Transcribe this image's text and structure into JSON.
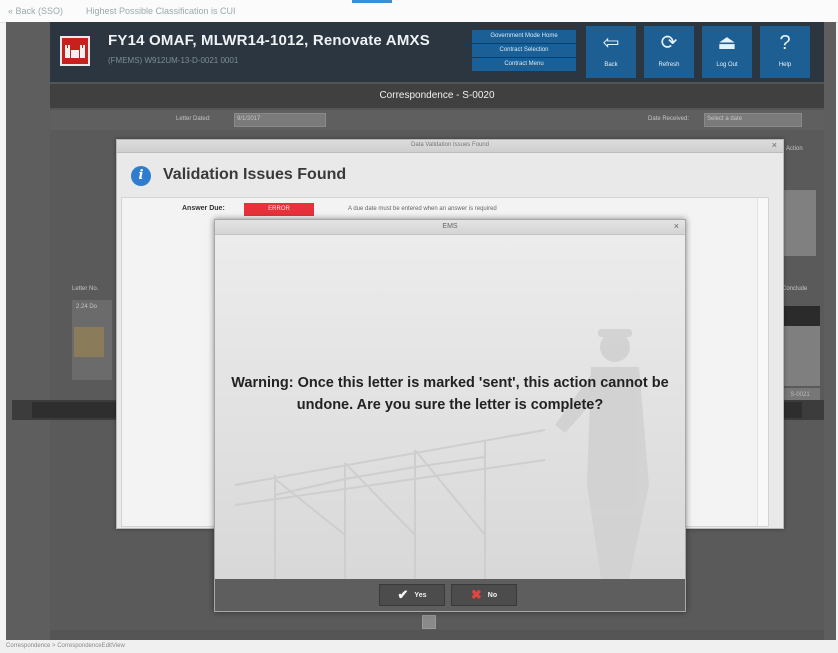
{
  "browser": {
    "crumb": "« Back (SSO)",
    "classification": "Highest Possible Classification is CUI"
  },
  "header": {
    "project_title": "FY14 OMAF, MLWR14-1012, Renovate AMXS",
    "project_subtitle": "(FMEMS) W912UM-13-D-0021 0001",
    "gov_buttons": [
      "Government Mode Home",
      "Contract Selection",
      "Contract Menu"
    ],
    "buttons": [
      {
        "label": "Back",
        "icon": "back-arrow-icon",
        "glyph": "⇦"
      },
      {
        "label": "Refresh",
        "icon": "refresh-icon",
        "glyph": "⟳"
      },
      {
        "label": "Log Out",
        "icon": "log-out-icon",
        "glyph": "⏏"
      },
      {
        "label": "Help",
        "icon": "help-icon",
        "glyph": "?"
      }
    ]
  },
  "subheader": {
    "title": "Correspondence - S-0020"
  },
  "background_form": {
    "letter_dated_label": "Letter Dated:",
    "letter_dated_value": "9/1/2017",
    "date_received_label": "Date Received:",
    "date_received_value": "Select a date",
    "letter_no_label": "Letter No.",
    "action_label": "Action",
    "conclude_label": "Conclude",
    "row_label": "2.24 Do",
    "right_tag": "S-0021",
    "status_path": "Correspondence > CorrespondenceEditView"
  },
  "validation_dialog": {
    "window_title": "Data Validation Issues Found",
    "heading": "Validation Issues Found",
    "issues": [
      {
        "field": "Answer Due:",
        "badge": "ERROR",
        "message": "A due date must be entered when an answer is required"
      }
    ]
  },
  "ems_dialog": {
    "window_title": "EMS",
    "message": "Warning: Once this letter is marked 'sent', this action cannot be undone. Are you sure the letter is complete?",
    "yes_label": "Yes",
    "no_label": "No"
  },
  "colors": {
    "header_bg": "#2c3640",
    "button_blue": "#1d5e93",
    "error_red": "#e8313a",
    "info_blue": "#2f7dcc",
    "logo_red": "#c8201c"
  }
}
